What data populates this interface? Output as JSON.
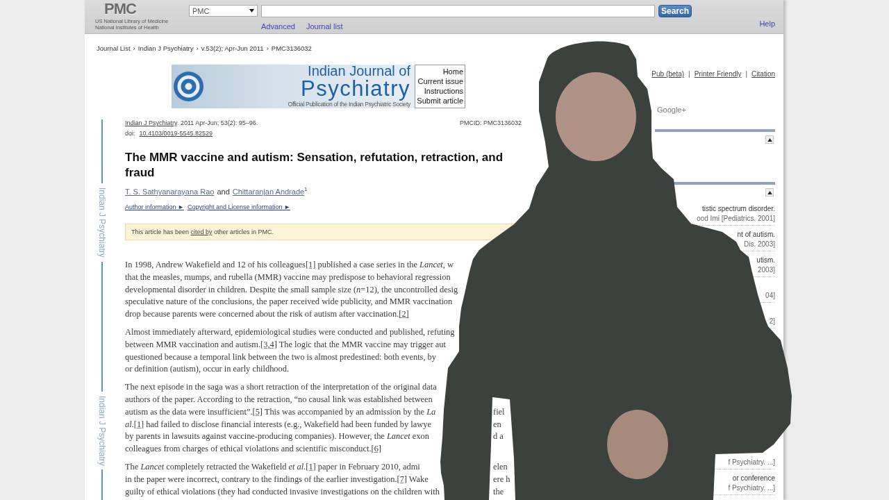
{
  "header": {
    "logo": {
      "text": "PMC",
      "subtitle_lines": [
        "US National Library of Medicine",
        "National Institutes of Health"
      ]
    },
    "database_select": {
      "value": "PMC"
    },
    "search_button": "Search",
    "links": [
      "Advanced",
      "Journal list"
    ],
    "help": "Help"
  },
  "breadcrumb": [
    {
      "label": "Journal List",
      "separator": "›"
    },
    {
      "label": "Indian J Psychiatry",
      "separator": "›"
    },
    {
      "label": "v.53(2); Apr-Jun 2011",
      "separator": "›"
    },
    {
      "label": "PMC3136032"
    }
  ],
  "journal_banner": {
    "title_top": "Indian Journal of",
    "title_main": "Psychiatry",
    "tagline": "Official Publication of the Indian Psychiatric Society",
    "menu": [
      "Home",
      "Current issue",
      "Instructions",
      "Submit article"
    ]
  },
  "side_labels": [
    "Indian J Psychiatry",
    "Indian J Psychiatry"
  ],
  "citation": {
    "journal": "Indian J Psychiatry",
    "details": ". 2011 Apr-Jun; 53(2): 95–96.",
    "pmcid": "PMCID: PMC3136032",
    "doi_label": "doi:",
    "doi": "10.4103/0019-5545.82529"
  },
  "article": {
    "title": "The MMR vaccine and autism: Sensation, refutation, retraction, and fraud",
    "authors": [
      {
        "name": "T. S. Sathyanarayana Rao"
      },
      {
        "name": "Chittaranjan Andrade",
        "affiliation": "1"
      }
    ],
    "author_joiner": "and",
    "info_links": [
      "Author information ►",
      "Copyright and License information ►"
    ],
    "notice": {
      "before": "This article has been ",
      "link": "cited by",
      "after": " other articles in PMC."
    },
    "paragraphs": [
      {
        "lines": [
          {
            "segments": [
              {
                "kind": "text",
                "text": "In 1998, Andrew Wakefield and 12 of his colleagues"
              },
              {
                "kind": "ref",
                "text": "[1]"
              },
              {
                "kind": "text",
                "text": " published a case series in the *Lancet*, w"
              }
            ]
          },
          {
            "segments": [
              {
                "kind": "text",
                "text": "that the measles, mumps, and rubella (MMR) vaccine may predispose to behavioral regression"
              }
            ]
          },
          {
            "segments": [
              {
                "kind": "text",
                "text": "developmental disorder in children. Despite the small sample size (*n*=12), the uncontrolled desig"
              }
            ]
          },
          {
            "segments": [
              {
                "kind": "text",
                "text": "speculative nature of the conclusions, the paper received wide publicity, and MMR vaccination"
              }
            ]
          },
          {
            "segments": [
              {
                "kind": "text",
                "text": "drop because parents were concerned about the risk of autism after vaccination."
              },
              {
                "kind": "ref",
                "text": "[2]"
              }
            ]
          }
        ]
      },
      {
        "lines": [
          {
            "segments": [
              {
                "kind": "text",
                "text": "Almost immediately afterward, epidemiological studies were conducted and published, refuting"
              }
            ]
          },
          {
            "segments": [
              {
                "kind": "text",
                "text": "between MMR vaccination and autism."
              },
              {
                "kind": "ref",
                "text": "[3,4]"
              },
              {
                "kind": "text",
                "text": " The logic that the MMR vaccine may trigger aut"
              }
            ]
          },
          {
            "segments": [
              {
                "kind": "text",
                "text": "questioned because a temporal link between the two is almost predestined: both events, by"
              }
            ]
          },
          {
            "segments": [
              {
                "kind": "text",
                "text": "or definition (autism), occur in early childhood."
              }
            ]
          }
        ]
      },
      {
        "lines": [
          {
            "segments": [
              {
                "kind": "text",
                "text": "The next episode in the saga was a short retraction of the interpretation of the original data"
              }
            ]
          },
          {
            "segments": [
              {
                "kind": "text",
                "text": "authors of the paper. According to the retraction, “no causal link was established between"
              }
            ]
          },
          {
            "segments": [
              {
                "kind": "text",
                "text": "autism as the data were insufficient”."
              },
              {
                "kind": "ref",
                "text": "[5]"
              },
              {
                "kind": "text",
                "text": " This was accompanied by an admission by the *La*"
              }
            ],
            "fragment": "fiel"
          },
          {
            "segments": [
              {
                "kind": "text",
                "text": "*al.*"
              },
              {
                "kind": "ref",
                "text": "[1]"
              },
              {
                "kind": "text",
                "text": " had failed to disclose financial interests (e.g., Wakefield had been funded by lawye"
              }
            ],
            "fragment": "en"
          },
          {
            "segments": [
              {
                "kind": "text",
                "text": "by parents in lawsuits against vaccine-producing companies). However, the *Lancet* exon"
              }
            ],
            "fragment": "d a"
          },
          {
            "segments": [
              {
                "kind": "text",
                "text": "colleagues from charges of ethical violations and scientific misconduct."
              },
              {
                "kind": "ref",
                "text": "[6]"
              }
            ]
          }
        ]
      },
      {
        "lines": [
          {
            "segments": [
              {
                "kind": "text",
                "text": "The *Lancet* completely retracted the Wakefield *et al.*"
              },
              {
                "kind": "ref",
                "text": "[1]"
              },
              {
                "kind": "text",
                "text": " paper in February 2010, admi"
              }
            ],
            "fragment": "elen"
          },
          {
            "segments": [
              {
                "kind": "text",
                "text": "in the paper were incorrect, contrary to the findings of the earlier investigation."
              },
              {
                "kind": "ref",
                "text": "[7]"
              },
              {
                "kind": "text",
                "text": " Wake"
              }
            ],
            "fragment": "ere h"
          },
          {
            "segments": [
              {
                "kind": "text",
                "text": "guilty of ethical violations (they had conducted invasive investigations on the children with"
              }
            ],
            "fragment": "the"
          }
        ]
      }
    ]
  },
  "article_tools": [
    {
      "label": "Pub (beta)",
      "separator": "|"
    },
    {
      "label": "Printer Friendly",
      "separator": "|"
    },
    {
      "label": "Citation"
    }
  ],
  "share": {
    "label": "Google+"
  },
  "panels": [
    {
      "expanded": true
    },
    {
      "expanded": true,
      "items_top": [
        {
          "title": "tistic spectrum disorder.",
          "source": "ood Imi [Pediatrics. 2001]"
        },
        {
          "title": "nt of autism.",
          "source": "Dis. 2003]"
        },
        {
          "title": "utism.",
          "source": "2003]"
        },
        {
          "source": "04]"
        },
        {
          "source": "2]"
        }
      ],
      "items_bottom": [
        {
          "source": "f Psychiatry. ...]"
        },
        {
          "title": "or conference",
          "source": "f Psychiatry. ...]"
        }
      ]
    }
  ]
}
